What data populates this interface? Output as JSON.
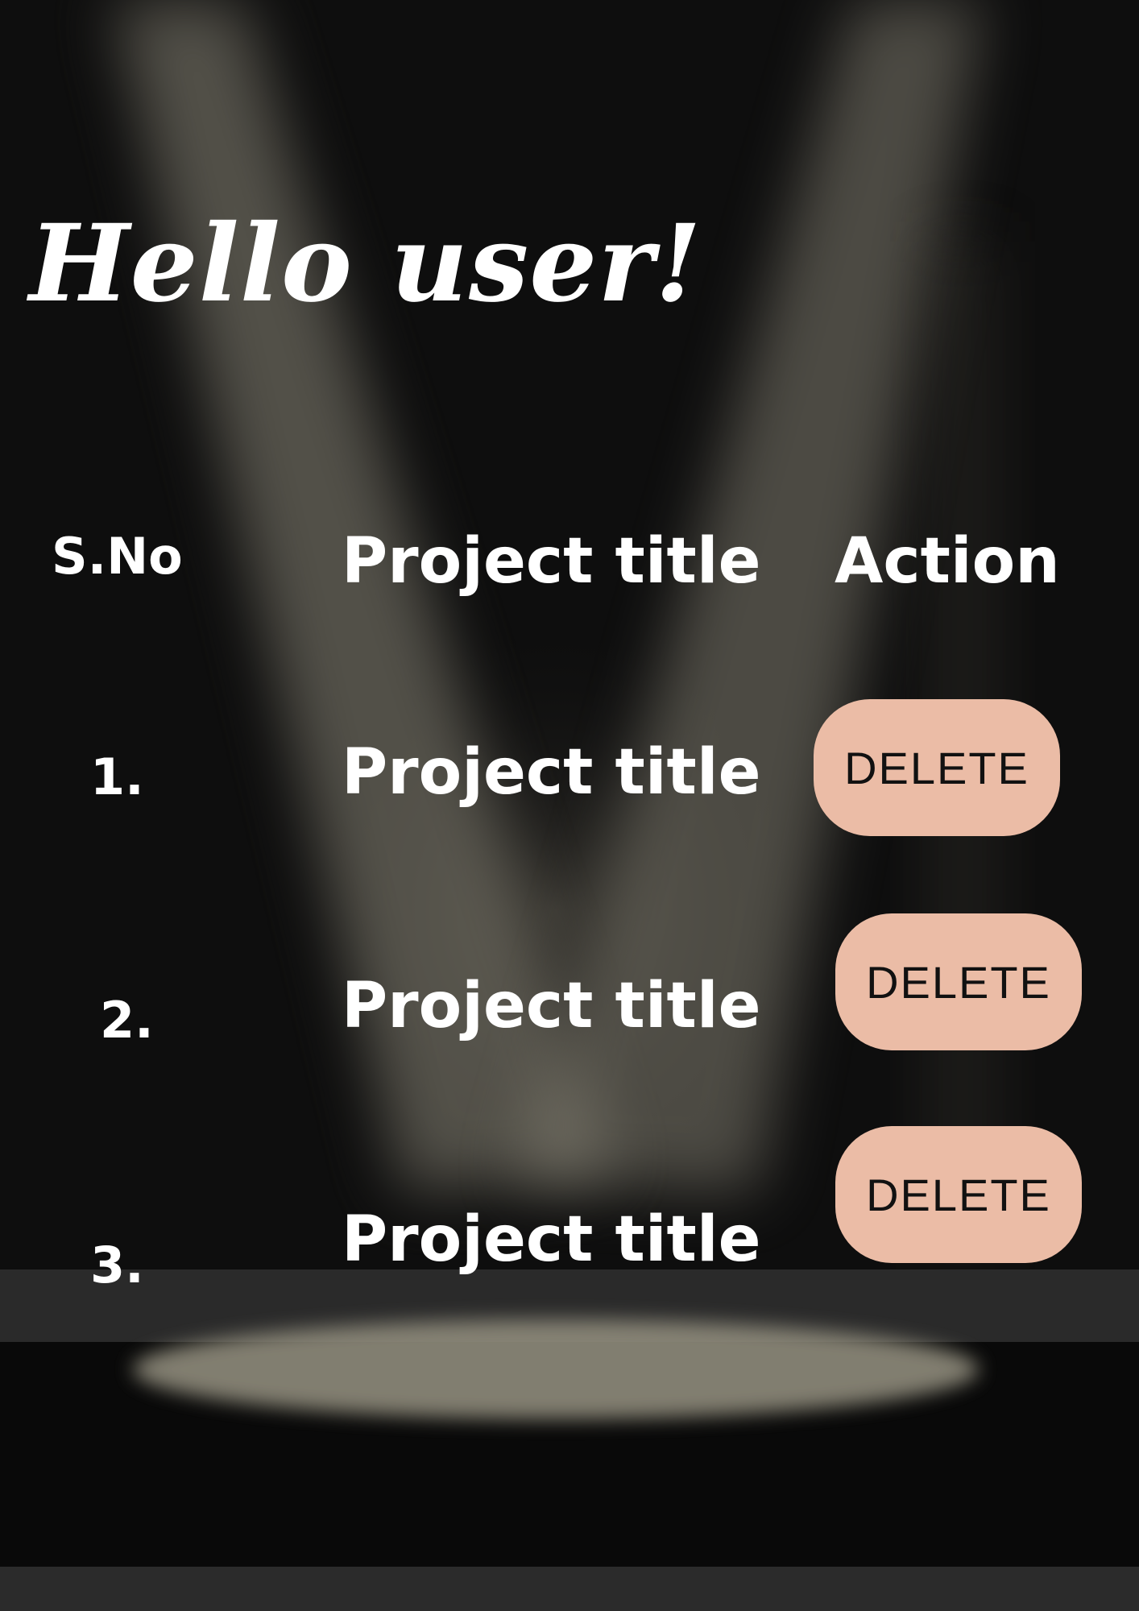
{
  "greeting": "Hello user!",
  "table": {
    "headers": {
      "sno": "S.No",
      "title": "Project title",
      "action": "Action"
    },
    "rows": [
      {
        "sno": "1.",
        "title": "Project title",
        "action_label": "DELETE"
      },
      {
        "sno": "2.",
        "title": "Project title",
        "action_label": "DELETE"
      },
      {
        "sno": "3.",
        "title": "Project title",
        "action_label": "DELETE"
      }
    ]
  },
  "colors": {
    "background": "#0d0d0d",
    "text": "#ffffff",
    "button": "#ebbca6",
    "button_text": "#111111",
    "spotlight": "#a6a192"
  }
}
